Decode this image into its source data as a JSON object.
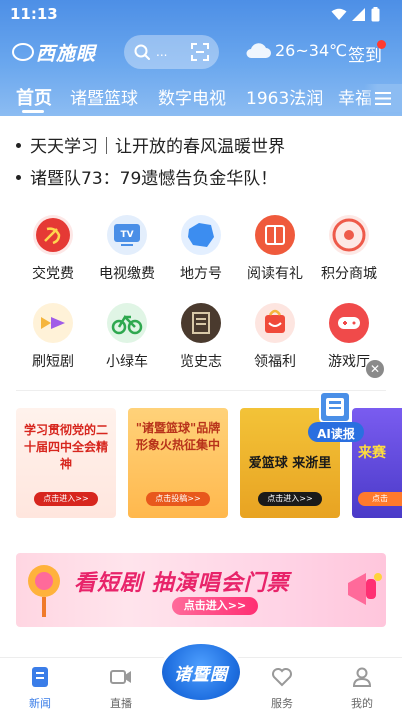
{
  "status_bar": {
    "time": "11:13"
  },
  "header": {
    "logo_text": "西施眼",
    "search_placeholder": "...",
    "weather": "26~34℃",
    "signin_label": "签到"
  },
  "tabs": [
    {
      "label": "首页",
      "active": true
    },
    {
      "label": "诸暨篮球"
    },
    {
      "label": "数字电视"
    },
    {
      "label": "1963法润"
    },
    {
      "label": "幸福"
    }
  ],
  "headlines": [
    "天天学习｜让开放的春风温暖世界",
    "诸暨队73：79遗憾告负金华队！"
  ],
  "services": [
    {
      "label": "交党费",
      "icon": "party-icon",
      "color": "#e53935"
    },
    {
      "label": "电视缴费",
      "icon": "tv-icon",
      "color": "#4a8fe7"
    },
    {
      "label": "地方号",
      "icon": "map-icon",
      "color": "#3c8df0"
    },
    {
      "label": "阅读有礼",
      "icon": "book-icon",
      "color": "#ef5a3c"
    },
    {
      "label": "积分商城",
      "icon": "points-icon",
      "color": "#ee5a4a"
    },
    {
      "label": "刷短剧",
      "icon": "short-drama-icon",
      "color": "#f5b53c"
    },
    {
      "label": "小绿车",
      "icon": "bike-icon",
      "color": "#2fa84f"
    },
    {
      "label": "览史志",
      "icon": "history-icon",
      "color": "#5a4a3a"
    },
    {
      "label": "领福利",
      "icon": "gift-icon",
      "color": "#f04a3a"
    },
    {
      "label": "游戏厅",
      "icon": "gamepad-icon",
      "color": "#f04a4a"
    }
  ],
  "banners": [
    {
      "title": "学习贯彻党的二十届四中全会精神",
      "button": "点击进入>>"
    },
    {
      "title": "\"诸暨篮球\"品牌形象火热征集中",
      "button": "点击投稿>>"
    },
    {
      "title": "爱篮球 来浙里",
      "button": "点击进入>>"
    },
    {
      "title": "来赛",
      "button": "点击"
    }
  ],
  "ai_badge": "AI读报",
  "promo": {
    "title": "看短剧 抽演唱会门票",
    "button": "点击进入>>"
  },
  "bottom_nav": [
    {
      "label": "新闻",
      "icon": "news-icon",
      "active": true
    },
    {
      "label": "直播",
      "icon": "live-icon"
    },
    {
      "label": "服务",
      "icon": "heart-icon"
    },
    {
      "label": "我的",
      "icon": "profile-icon"
    }
  ],
  "center_badge": "诸暨圈",
  "colors": {
    "accent": "#3a7de8",
    "header_top": "#4d8fe6",
    "header_bottom": "#8cbcf2",
    "badge": "#ff3b30"
  }
}
